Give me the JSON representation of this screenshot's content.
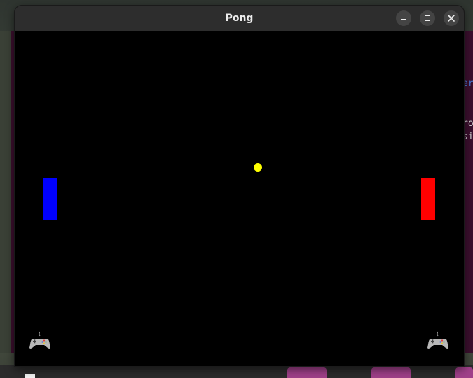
{
  "window": {
    "title": "Pong",
    "controls": [
      "minimize",
      "maximize",
      "close"
    ]
  },
  "game": {
    "background_color": "#000000",
    "left_paddle_color": "#0000ff",
    "right_paddle_color": "#ff0000",
    "ball_color": "#ffff00",
    "left_player_icon": "gamepad-icon",
    "right_player_icon": "gamepad-icon"
  },
  "background_terminal": {
    "lines": [
      "er",
      "",
      "",
      "ro",
      "si"
    ]
  }
}
